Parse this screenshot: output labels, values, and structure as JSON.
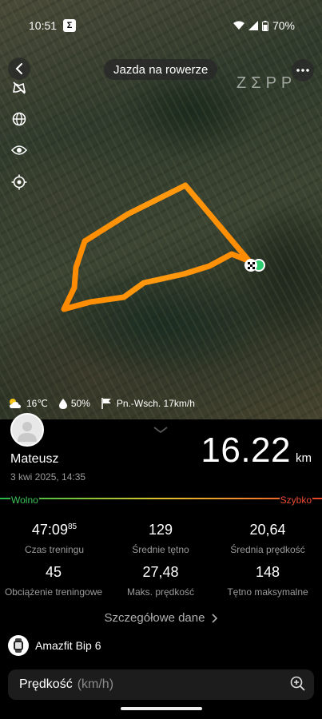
{
  "status_bar": {
    "time": "10:51",
    "app_icon_glyph": "Σ",
    "battery": "70%",
    "icons": [
      "wifi-icon",
      "signal-icon",
      "battery-icon"
    ]
  },
  "header": {
    "title": "Jazda na rowerze",
    "watermark": "ZΣPP"
  },
  "map_tools": [
    "layers-off-icon",
    "globe-icon",
    "eye-icon",
    "locate-icon"
  ],
  "route": {
    "color_start": "#f5a623",
    "color_end": "#ff7a00"
  },
  "weather": {
    "temperature": "16℃",
    "humidity": "50%",
    "wind": "Pn.-Wsch. 17km/h"
  },
  "summary": {
    "user_name": "Mateusz",
    "date": "3 kwi 2025, 14:35",
    "distance_value": "16.22",
    "distance_unit": "km",
    "scale_left": "Wolno",
    "scale_right": "Szybko"
  },
  "stats": [
    {
      "value": "47:09",
      "sup": "85",
      "label": "Czas treningu"
    },
    {
      "value": "129",
      "sup": "",
      "label": "Średnie tętno"
    },
    {
      "value": "20,64",
      "sup": "",
      "label": "Średnia prędkość"
    },
    {
      "value": "45",
      "sup": "",
      "label": "Obciążenie treningowe"
    },
    {
      "value": "27,48",
      "sup": "",
      "label": "Maks. prędkość"
    },
    {
      "value": "148",
      "sup": "",
      "label": "Tętno maksymalne"
    }
  ],
  "details_link": "Szczegółowe dane",
  "device": {
    "name": "Amazfit Bip 6"
  },
  "speed_card": {
    "title": "Prędkość",
    "unit": "(km/h)"
  }
}
